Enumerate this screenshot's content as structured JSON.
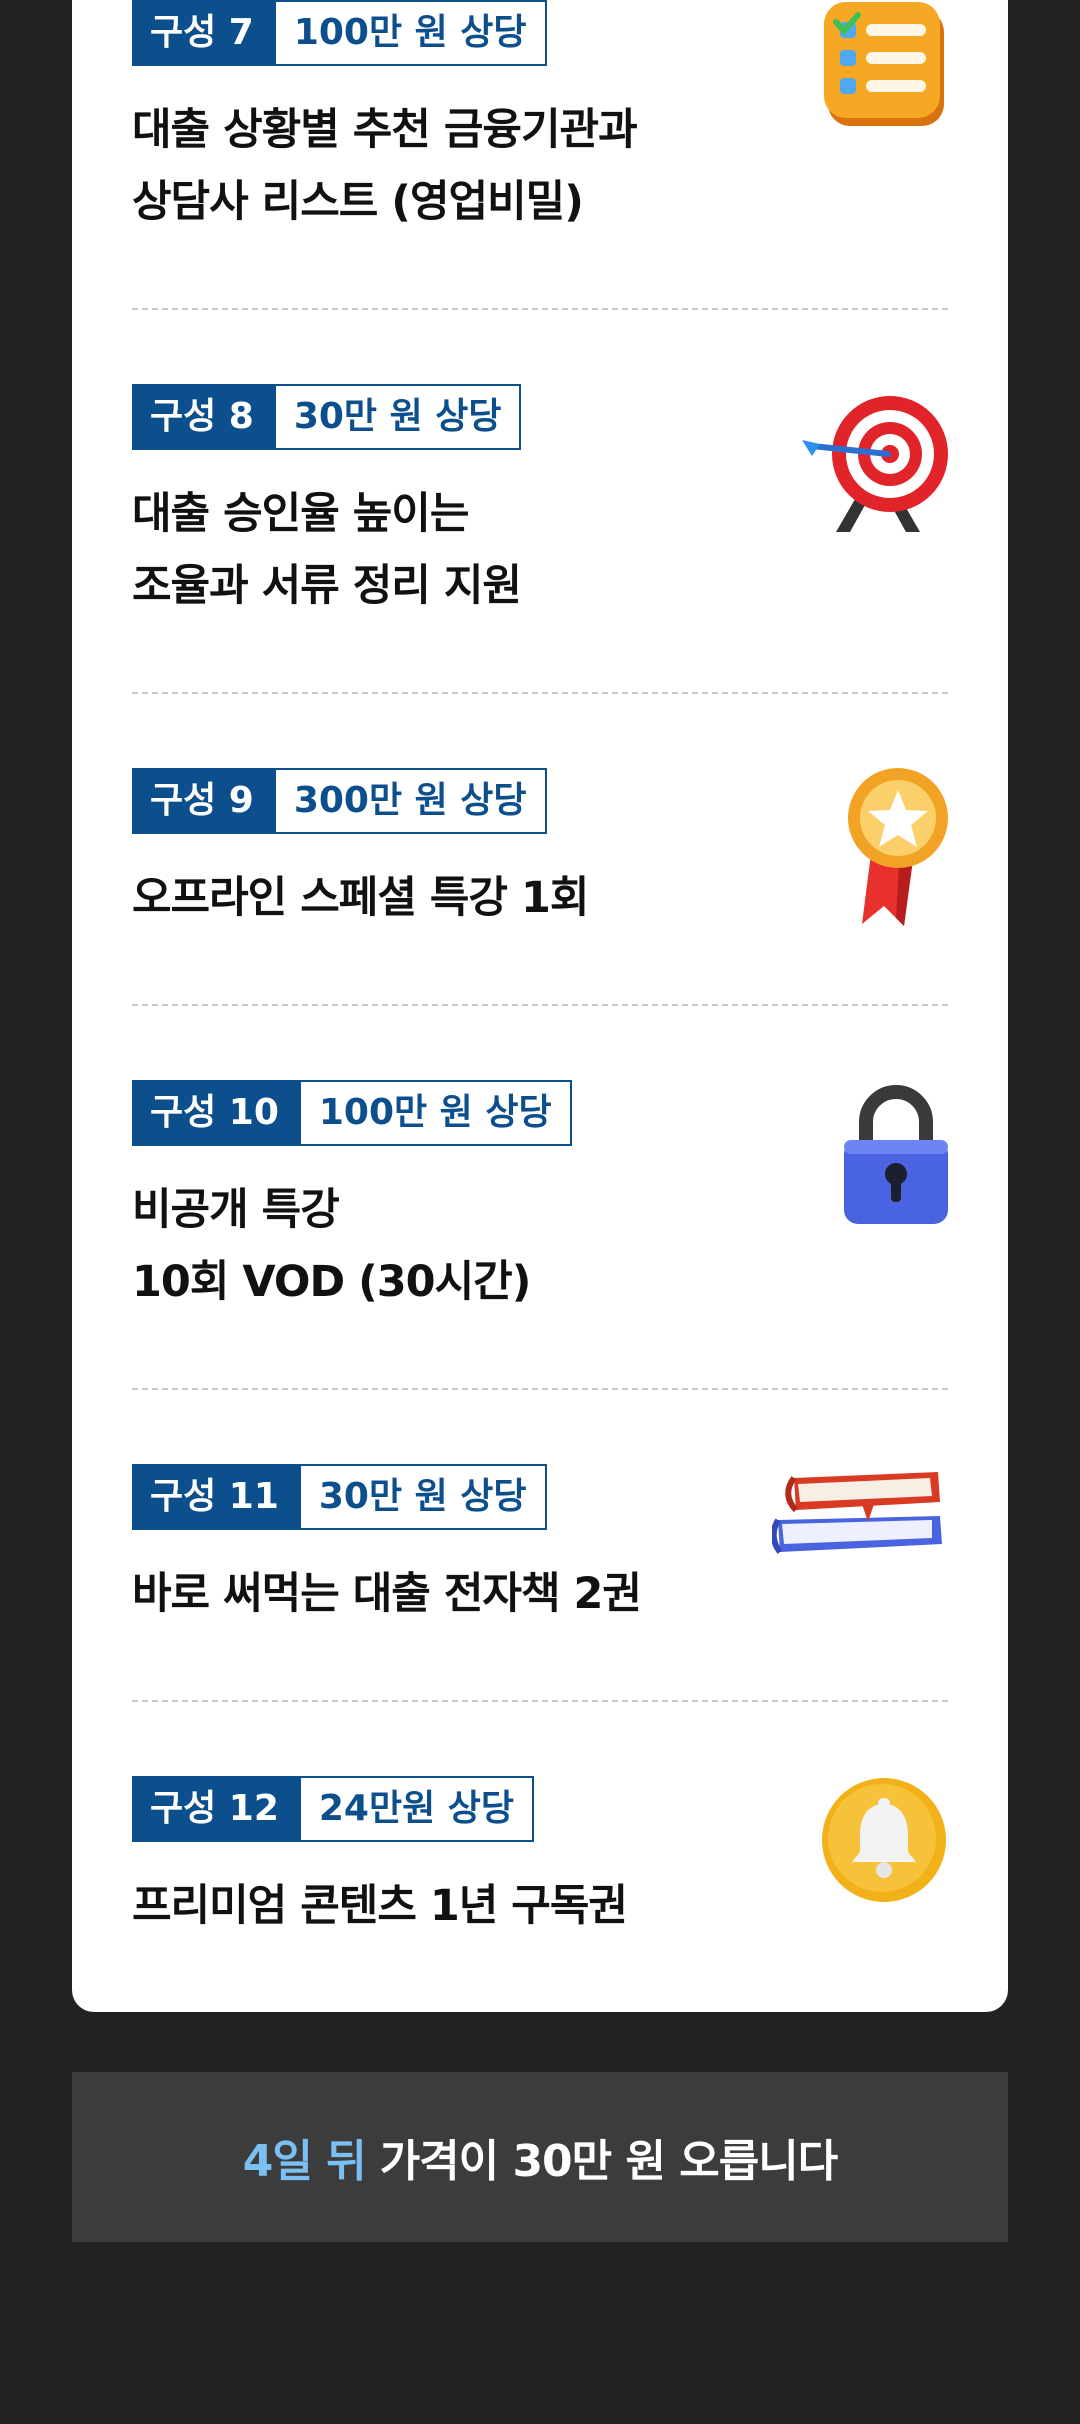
{
  "items": [
    {
      "num": "구성 7",
      "value": "100만 원 상당",
      "lines": [
        "대출 상황별 추천 금융기관과",
        "상담사 리스트 (영업비밀)"
      ],
      "icon": "checklist-icon"
    },
    {
      "num": "구성 8",
      "value": "30만 원 상당",
      "lines": [
        "대출 승인율 높이는",
        "조율과 서류 정리 지원"
      ],
      "icon": "target-icon"
    },
    {
      "num": "구성 9",
      "value": "300만 원 상당",
      "lines": [
        "오프라인 스페셜 특강 1회"
      ],
      "icon": "medal-icon"
    },
    {
      "num": "구성 10",
      "value": "100만 원 상당",
      "lines": [
        "비공개 특강",
        "10회 VOD (30시간)"
      ],
      "icon": "lock-icon"
    },
    {
      "num": "구성 11",
      "value": "30만 원 상당",
      "lines": [
        "바로 써먹는 대출 전자책 2권"
      ],
      "icon": "books-icon"
    },
    {
      "num": "구성 12",
      "value": "24만원 상당",
      "lines": [
        "프리미엄 콘텐츠 1년 구독권"
      ],
      "icon": "bell-icon"
    }
  ],
  "banner": {
    "highlight": "4일 뒤",
    "text": "가격이 30만 원 오릅니다"
  },
  "colors": {
    "brand": "#0c4f8c",
    "highlight": "#7cc0f3",
    "page_bg": "#222222",
    "banner_bg": "#3c3c3c"
  }
}
